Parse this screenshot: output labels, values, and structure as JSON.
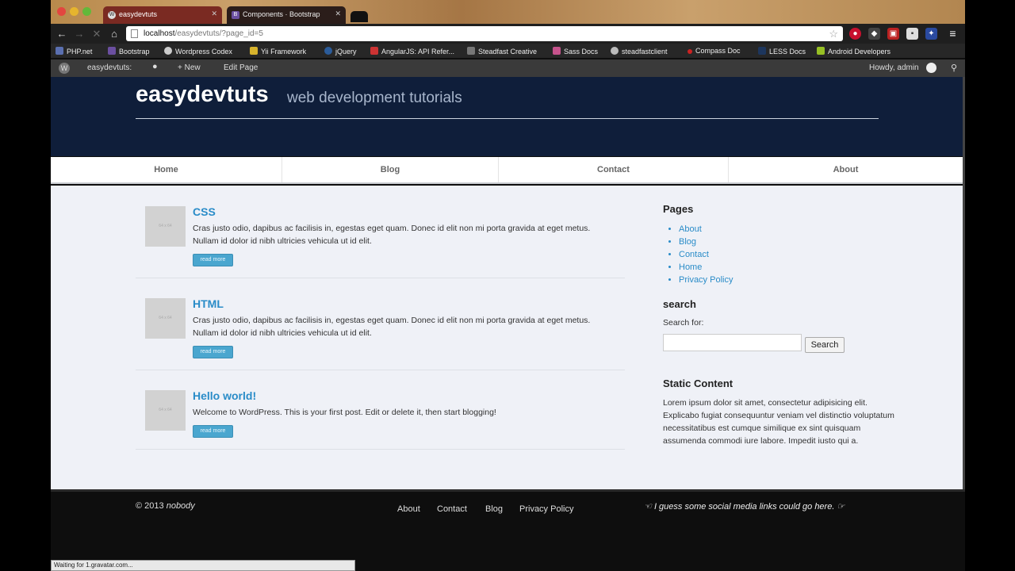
{
  "browser": {
    "tabs": [
      {
        "label": "easydevtuts",
        "icon": "wordpress-icon"
      },
      {
        "label": "Components · Bootstrap",
        "icon": "bootstrap-icon"
      }
    ],
    "url_host": "localhost",
    "url_path": "/easydevtuts/?page_id=5",
    "bookmarks": [
      "PHP.net",
      "Bootstrap",
      "Wordpress Codex",
      "Yii Framework",
      "jQuery",
      "AngularJS: API Refer...",
      "Steadfast Creative",
      "Sass Docs",
      "steadfastclient",
      "Compass Doc",
      "LESS Docs",
      "Android Developers"
    ],
    "status": "Waiting for 1.gravatar.com..."
  },
  "wpbar": {
    "site": "easydevtuts:",
    "new": "+ New",
    "edit": "Edit Page",
    "howdy": "Howdy, admin"
  },
  "header": {
    "title": "easydevtuts",
    "description": "web development tutorials"
  },
  "nav": [
    "Home",
    "Blog",
    "Contact",
    "About"
  ],
  "posts": [
    {
      "title": "CSS",
      "excerpt": "Cras justo odio, dapibus ac facilisis in, egestas eget quam. Donec id elit non mi porta gravida at eget metus. Nullam id dolor id nibh ultricies vehicula ut id elit.",
      "thumb": "64 x 64",
      "more": "read more"
    },
    {
      "title": "HTML",
      "excerpt": "Cras justo odio, dapibus ac facilisis in, egestas eget quam. Donec id elit non mi porta gravida at eget metus. Nullam id dolor id nibh ultricies vehicula ut id elit.",
      "thumb": "64 x 64",
      "more": "read more"
    },
    {
      "title": "Hello world!",
      "excerpt": "Welcome to WordPress. This is your first post. Edit or delete it, then start blogging!",
      "thumb": "64 x 64",
      "more": "read more"
    }
  ],
  "sidebar": {
    "pages_heading": "Pages",
    "pages": [
      "About",
      "Blog",
      "Contact",
      "Home",
      "Privacy Policy"
    ],
    "search_heading": "search",
    "search_label": "Search for:",
    "search_button": "Search",
    "static_heading": "Static Content",
    "static_text": "Lorem ipsum dolor sit amet, consectetur adipisicing elit. Explicabo fugiat consequuntur veniam vel distinctio voluptatum necessitatibus est cumque similique ex sint quisquam assumenda commodi iure labore. Impedit iusto qui a."
  },
  "footer": {
    "copyright": "© 2013",
    "author": "nobody",
    "links": [
      "About",
      "Contact",
      "Blog",
      "Privacy Policy"
    ],
    "social": "I guess some social media links could go here."
  },
  "colors": {
    "header_bg": "#0f1e3a",
    "link": "#2a8cc8",
    "content_bg": "#eff1f7",
    "readmore": "#4aa6cf"
  }
}
